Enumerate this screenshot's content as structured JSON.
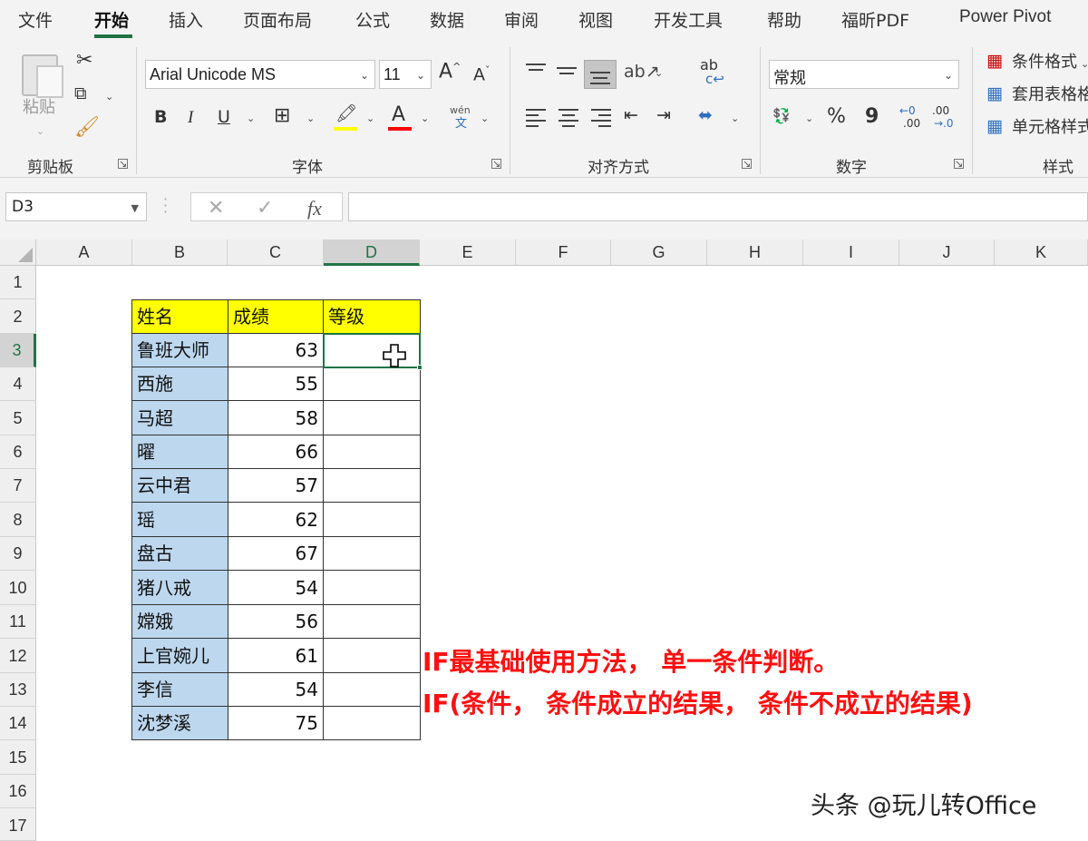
{
  "tabs": [
    "文件",
    "开始",
    "插入",
    "页面布局",
    "公式",
    "数据",
    "审阅",
    "视图",
    "开发工具",
    "帮助",
    "福昕PDF",
    "Power Pivot"
  ],
  "active_tab": "开始",
  "ribbon": {
    "clipboard": {
      "label": "剪贴板",
      "paste_label": "粘贴"
    },
    "font": {
      "label": "字体",
      "font_name": "Arial Unicode MS",
      "font_size": "11",
      "bold": "B",
      "italic": "I",
      "underline": "U",
      "font_color_glyph": "A",
      "phonetic_top": "wén",
      "phonetic_bottom": "文",
      "highlight_color": "#ffff00",
      "font_color": "#ff0000"
    },
    "alignment": {
      "label": "对齐方式",
      "wrap_glyph": "ab"
    },
    "number": {
      "label": "数字",
      "format": "常规",
      "percent": "%",
      "comma": "9",
      "increase_decimal": ".00",
      "decrease_decimal": ".00",
      "inc_small": "←0",
      "dec_small": "→.0"
    },
    "styles": {
      "label": "样式",
      "items": [
        "条件格式",
        "套用表格格",
        "单元格样式"
      ]
    }
  },
  "formula_bar": {
    "name_box": "D3",
    "cancel": "✕",
    "enter": "✓",
    "fx": "fx",
    "value": ""
  },
  "columns": [
    "A",
    "B",
    "C",
    "D",
    "E",
    "F",
    "G",
    "H",
    "I",
    "J",
    "K"
  ],
  "rows": [
    "1",
    "2",
    "3",
    "4",
    "5",
    "6",
    "7",
    "8",
    "9",
    "10",
    "11",
    "12",
    "13",
    "14",
    "15",
    "16",
    "17"
  ],
  "selected_cell": "D3",
  "table": {
    "headers": [
      "姓名",
      "成绩",
      "等级"
    ],
    "rows": [
      [
        "鲁班大师",
        "63",
        ""
      ],
      [
        "西施",
        "55",
        ""
      ],
      [
        "马超",
        "58",
        ""
      ],
      [
        "曜",
        "66",
        ""
      ],
      [
        "云中君",
        "57",
        ""
      ],
      [
        "瑶",
        "62",
        ""
      ],
      [
        "盘古",
        "67",
        ""
      ],
      [
        "猪八戒",
        "54",
        ""
      ],
      [
        "嫦娥",
        "56",
        ""
      ],
      [
        "上官婉儿",
        "61",
        ""
      ],
      [
        "李信",
        "54",
        ""
      ],
      [
        "沈梦溪",
        "75",
        ""
      ]
    ]
  },
  "notes": {
    "line1": "IF最基础使用方法， 单一条件判断。",
    "line2": "IF(条件， 条件成立的结果， 条件不成立的结果)",
    "color": "#ff1010"
  },
  "watermark": "头条 @玩儿转Office",
  "colors": {
    "accent": "#217346",
    "name_fill": "#bdd7ee",
    "header_fill": "#ffff00"
  }
}
